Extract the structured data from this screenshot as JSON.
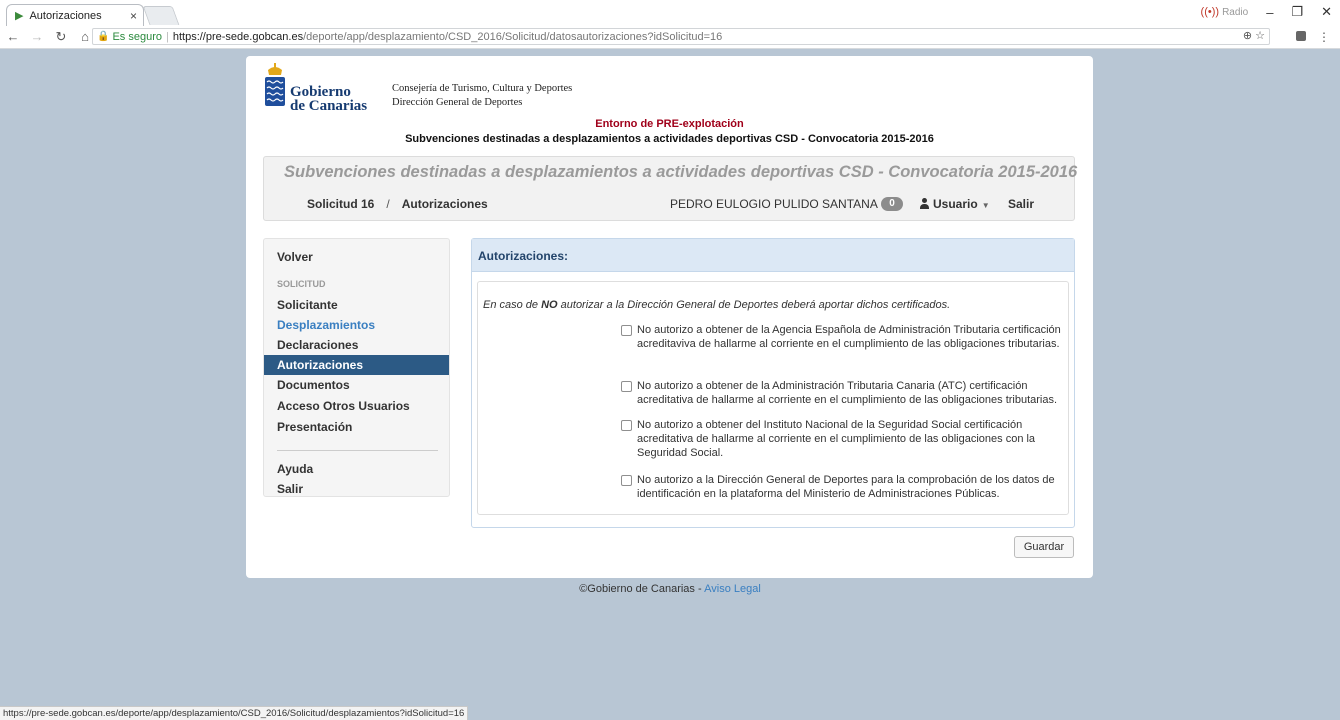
{
  "browser": {
    "tab_title": "Autorizaciones",
    "tab_close": "×",
    "radio_label": "Radio",
    "url_secure": "Es seguro",
    "url_host": "https://pre-sede.gobcan.es",
    "url_path": "/deporte/app/desplazamiento/CSD_2016/Solicitud/datosautorizaciones?idSolicitud=16",
    "status_url": "https://pre-sede.gobcan.es/deporte/app/desplazamiento/CSD_2016/Solicitud/desplazamientos?idSolicitud=16"
  },
  "header": {
    "logo_line1": "Gobierno",
    "logo_line2": "de Canarias",
    "consejeria": "Consejería de Turismo, Cultura y Deportes",
    "direccion": "Dirección General de Deportes",
    "entorno": "Entorno de PRE-explotación",
    "subtitle": "Subvenciones destinadas a desplazamientos a actividades deportivas CSD - Convocatoria 2015-2016"
  },
  "app_header": {
    "title": "Subvenciones destinadas a desplazamientos a actividades deportivas CSD - Convocatoria 2015-2016",
    "breadcrumb_1": "Solicitud 16",
    "breadcrumb_sep": "/",
    "breadcrumb_2": "Autorizaciones",
    "user_name": "PEDRO EULOGIO PULIDO SANTANA",
    "notifications": "0",
    "user_menu": "Usuario",
    "logout": "Salir"
  },
  "sidebar": {
    "back": "Volver",
    "section": "SOLICITUD",
    "items": [
      "Solicitante",
      "Desplazamientos",
      "Declaraciones",
      "Autorizaciones",
      "Documentos",
      "Acceso Otros Usuarios",
      "Presentación"
    ],
    "active_item": "Autorizaciones",
    "help": "Ayuda",
    "exit": "Salir"
  },
  "panel": {
    "title": "Autorizaciones:",
    "note_pre": "En caso de ",
    "note_bold": "NO",
    "note_post": " autorizar a la Dirección General de Deportes deberá aportar dichos certificados.",
    "options": [
      "No autorizo a obtener de la Agencia Española de Administración Tributaria certificación acreditaviva de hallarme al corriente en el cumplimiento de las obligaciones tributarias.",
      "No autorizo a obtener de la Administración Tributaria Canaria (ATC) certificación acreditativa de hallarme al corriente en el cumplimiento de las obligaciones tributarias.",
      "No autorizo a obtener del Instituto Nacional de la Seguridad Social certificación acreditativa de hallarme al corriente en el cumplimiento de las obligaciones con la Seguridad Social.",
      "No autorizo a la Dirección General de Deportes para la comprobación de los datos de identificación en la plataforma del Ministerio de Administraciones Públicas."
    ],
    "save": "Guardar"
  },
  "footer": {
    "copyright": "©Gobierno de Canarias - ",
    "link": "Aviso Legal"
  },
  "colors": {
    "active_nav": "#2c5a85",
    "link": "#3a7fc1",
    "entorno": "#a0001a",
    "page_bg": "#b8c6d4"
  }
}
